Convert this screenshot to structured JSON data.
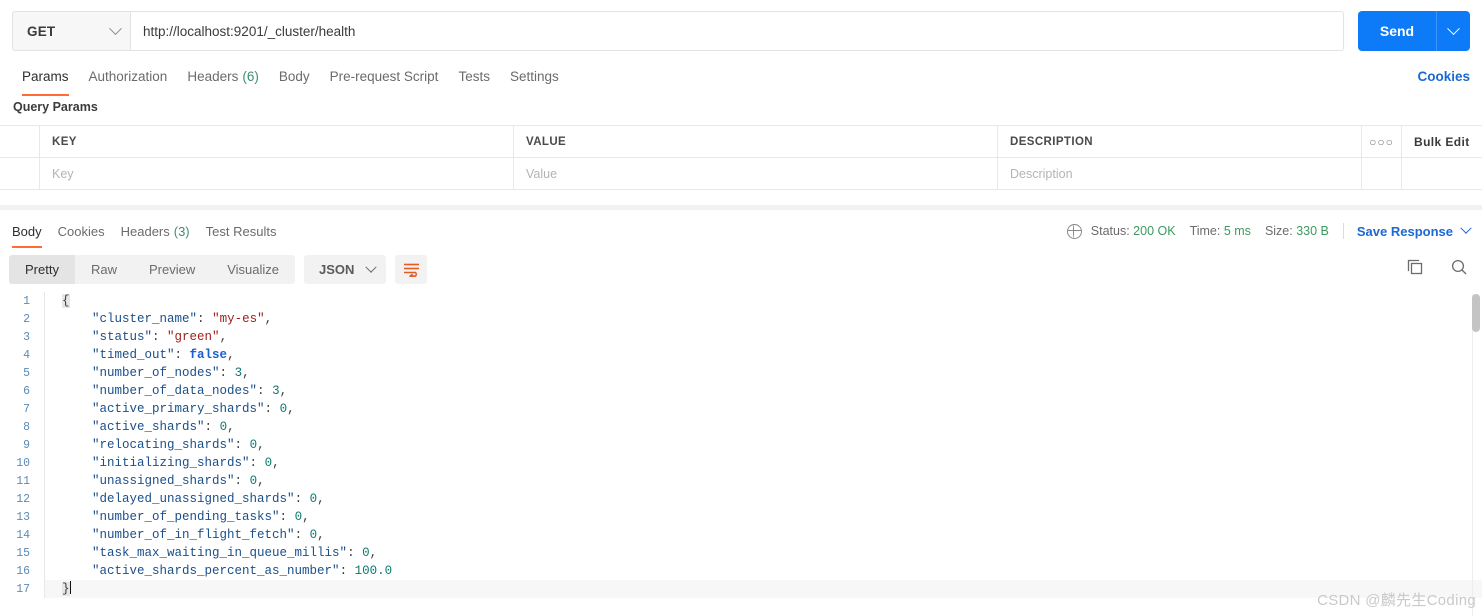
{
  "request": {
    "method": "GET",
    "url": "http://localhost:9201/_cluster/health",
    "send_label": "Send",
    "tabs": [
      {
        "label": "Params",
        "count": ""
      },
      {
        "label": "Authorization",
        "count": ""
      },
      {
        "label": "Headers",
        "count": "(6)"
      },
      {
        "label": "Body",
        "count": ""
      },
      {
        "label": "Pre-request Script",
        "count": ""
      },
      {
        "label": "Tests",
        "count": ""
      },
      {
        "label": "Settings",
        "count": ""
      }
    ],
    "cookies_link": "Cookies",
    "query_params_label": "Query Params"
  },
  "params_table": {
    "headers": {
      "key": "KEY",
      "value": "VALUE",
      "description": "DESCRIPTION"
    },
    "dots": "○○○",
    "bulk_edit": "Bulk Edit",
    "placeholders": {
      "key": "Key",
      "value": "Value",
      "description": "Description"
    }
  },
  "response": {
    "tabs": [
      {
        "label": "Body",
        "count": ""
      },
      {
        "label": "Cookies",
        "count": ""
      },
      {
        "label": "Headers",
        "count": "(3)"
      },
      {
        "label": "Test Results",
        "count": ""
      }
    ],
    "status_label": "Status:",
    "status_value": "200 OK",
    "time_label": "Time:",
    "time_value": "5 ms",
    "size_label": "Size:",
    "size_value": "330 B",
    "save_response": "Save Response",
    "format_pills": [
      "Pretty",
      "Raw",
      "Preview",
      "Visualize"
    ],
    "format_selected": "Pretty",
    "content_type": "JSON",
    "icons": {
      "wrap": "word-wrap-icon",
      "copy": "copy-icon",
      "search": "search-icon",
      "globe": "globe-icon"
    }
  },
  "code": {
    "lines": [
      {
        "n": "1",
        "segs": [
          {
            "t": "{",
            "c": "brace"
          }
        ]
      },
      {
        "n": "2",
        "segs": [
          {
            "t": "    ",
            "c": "p"
          },
          {
            "t": "\"cluster_name\"",
            "c": "k"
          },
          {
            "t": ": ",
            "c": "p"
          },
          {
            "t": "\"my-es\"",
            "c": "s"
          },
          {
            "t": ",",
            "c": "p"
          }
        ]
      },
      {
        "n": "3",
        "segs": [
          {
            "t": "    ",
            "c": "p"
          },
          {
            "t": "\"status\"",
            "c": "k"
          },
          {
            "t": ": ",
            "c": "p"
          },
          {
            "t": "\"green\"",
            "c": "s"
          },
          {
            "t": ",",
            "c": "p"
          }
        ]
      },
      {
        "n": "4",
        "segs": [
          {
            "t": "    ",
            "c": "p"
          },
          {
            "t": "\"timed_out\"",
            "c": "k"
          },
          {
            "t": ": ",
            "c": "p"
          },
          {
            "t": "false",
            "c": "b"
          },
          {
            "t": ",",
            "c": "p"
          }
        ]
      },
      {
        "n": "5",
        "segs": [
          {
            "t": "    ",
            "c": "p"
          },
          {
            "t": "\"number_of_nodes\"",
            "c": "k"
          },
          {
            "t": ": ",
            "c": "p"
          },
          {
            "t": "3",
            "c": "n"
          },
          {
            "t": ",",
            "c": "p"
          }
        ]
      },
      {
        "n": "6",
        "segs": [
          {
            "t": "    ",
            "c": "p"
          },
          {
            "t": "\"number_of_data_nodes\"",
            "c": "k"
          },
          {
            "t": ": ",
            "c": "p"
          },
          {
            "t": "3",
            "c": "n"
          },
          {
            "t": ",",
            "c": "p"
          }
        ]
      },
      {
        "n": "7",
        "segs": [
          {
            "t": "    ",
            "c": "p"
          },
          {
            "t": "\"active_primary_shards\"",
            "c": "k"
          },
          {
            "t": ": ",
            "c": "p"
          },
          {
            "t": "0",
            "c": "n"
          },
          {
            "t": ",",
            "c": "p"
          }
        ]
      },
      {
        "n": "8",
        "segs": [
          {
            "t": "    ",
            "c": "p"
          },
          {
            "t": "\"active_shards\"",
            "c": "k"
          },
          {
            "t": ": ",
            "c": "p"
          },
          {
            "t": "0",
            "c": "n"
          },
          {
            "t": ",",
            "c": "p"
          }
        ]
      },
      {
        "n": "9",
        "segs": [
          {
            "t": "    ",
            "c": "p"
          },
          {
            "t": "\"relocating_shards\"",
            "c": "k"
          },
          {
            "t": ": ",
            "c": "p"
          },
          {
            "t": "0",
            "c": "n"
          },
          {
            "t": ",",
            "c": "p"
          }
        ]
      },
      {
        "n": "10",
        "segs": [
          {
            "t": "    ",
            "c": "p"
          },
          {
            "t": "\"initializing_shards\"",
            "c": "k"
          },
          {
            "t": ": ",
            "c": "p"
          },
          {
            "t": "0",
            "c": "n"
          },
          {
            "t": ",",
            "c": "p"
          }
        ]
      },
      {
        "n": "11",
        "segs": [
          {
            "t": "    ",
            "c": "p"
          },
          {
            "t": "\"unassigned_shards\"",
            "c": "k"
          },
          {
            "t": ": ",
            "c": "p"
          },
          {
            "t": "0",
            "c": "n"
          },
          {
            "t": ",",
            "c": "p"
          }
        ]
      },
      {
        "n": "12",
        "segs": [
          {
            "t": "    ",
            "c": "p"
          },
          {
            "t": "\"delayed_unassigned_shards\"",
            "c": "k"
          },
          {
            "t": ": ",
            "c": "p"
          },
          {
            "t": "0",
            "c": "n"
          },
          {
            "t": ",",
            "c": "p"
          }
        ]
      },
      {
        "n": "13",
        "segs": [
          {
            "t": "    ",
            "c": "p"
          },
          {
            "t": "\"number_of_pending_tasks\"",
            "c": "k"
          },
          {
            "t": ": ",
            "c": "p"
          },
          {
            "t": "0",
            "c": "n"
          },
          {
            "t": ",",
            "c": "p"
          }
        ]
      },
      {
        "n": "14",
        "segs": [
          {
            "t": "    ",
            "c": "p"
          },
          {
            "t": "\"number_of_in_flight_fetch\"",
            "c": "k"
          },
          {
            "t": ": ",
            "c": "p"
          },
          {
            "t": "0",
            "c": "n"
          },
          {
            "t": ",",
            "c": "p"
          }
        ]
      },
      {
        "n": "15",
        "segs": [
          {
            "t": "    ",
            "c": "p"
          },
          {
            "t": "\"task_max_waiting_in_queue_millis\"",
            "c": "k"
          },
          {
            "t": ": ",
            "c": "p"
          },
          {
            "t": "0",
            "c": "n"
          },
          {
            "t": ",",
            "c": "p"
          }
        ]
      },
      {
        "n": "16",
        "segs": [
          {
            "t": "    ",
            "c": "p"
          },
          {
            "t": "\"active_shards_percent_as_number\"",
            "c": "k"
          },
          {
            "t": ": ",
            "c": "p"
          },
          {
            "t": "100.0",
            "c": "n"
          }
        ]
      },
      {
        "n": "17",
        "segs": [
          {
            "t": "}",
            "c": "brace"
          }
        ],
        "cursor": true,
        "current": true
      }
    ]
  },
  "watermark": "CSDN @麟先生Coding",
  "colors": {
    "accent_orange": "#ff6c37",
    "send_blue": "#0d7bf7",
    "link_blue": "#1b69d4",
    "status_green": "#3c9a5f"
  }
}
